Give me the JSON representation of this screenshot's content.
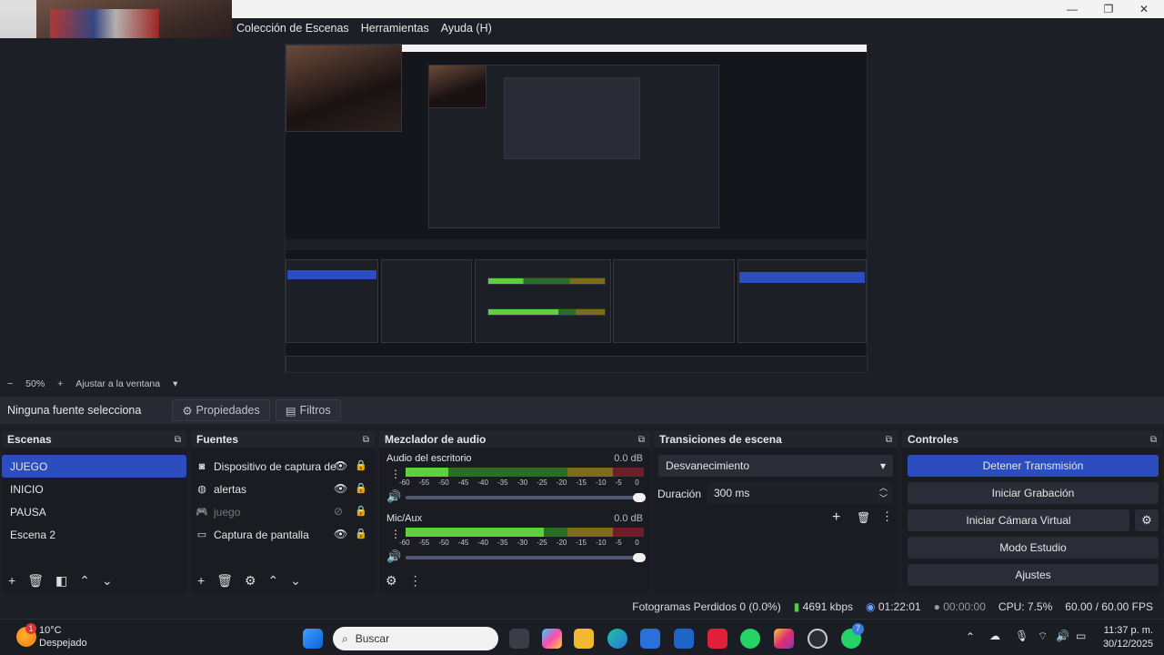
{
  "menu": [
    "Colección de Escenas",
    "Herramientas",
    "Ayuda (H)"
  ],
  "window_controls": {
    "minimize": "—",
    "maximize": "❐",
    "close": "✕"
  },
  "zoom": {
    "minus": "−",
    "level": "50%",
    "plus": "+",
    "fit_label": "Ajustar a la ventana",
    "dropdown": "▾"
  },
  "props": {
    "selection": "Ninguna fuente selecciona",
    "properties_label": "Propiedades",
    "filters_label": "Filtros"
  },
  "scenes": {
    "title": "Escenas",
    "items": [
      "JUEGO",
      "INICIO",
      "PAUSA",
      "Escena 2"
    ],
    "selected": "JUEGO"
  },
  "sources": {
    "title": "Fuentes",
    "items": [
      {
        "name": "Dispositivo de captura de",
        "icon": "camera-icon",
        "visible": true
      },
      {
        "name": "alertas",
        "icon": "globe-icon",
        "visible": true
      },
      {
        "name": "juego",
        "icon": "gamepad-icon",
        "visible": false
      },
      {
        "name": "Captura de pantalla",
        "icon": "monitor-icon",
        "visible": true
      }
    ]
  },
  "mixer": {
    "title": "Mezclador de audio",
    "scale": [
      "-60",
      "-55",
      "-50",
      "-45",
      "-40",
      "-35",
      "-30",
      "-25",
      "-20",
      "-15",
      "-10",
      "-5",
      "0"
    ],
    "channels": [
      {
        "name": "Audio del escritorio",
        "db": "0.0 dB",
        "level": 0.18,
        "volume": 1.0
      },
      {
        "name": "Mic/Aux",
        "db": "0.0 dB",
        "level": 0.58,
        "volume": 1.0
      }
    ]
  },
  "transitions": {
    "title": "Transiciones de escena",
    "selected": "Desvanecimiento",
    "duration_label": "Duración",
    "duration_value": "300 ms"
  },
  "controls": {
    "title": "Controles",
    "stop_stream": "Detener Transmisión",
    "start_recording": "Iniciar Grabación",
    "virtual_camera": "Iniciar Cámara Virtual",
    "studio_mode": "Modo Estudio",
    "settings": "Ajustes"
  },
  "status": {
    "dropped_frames": "Fotogramas Perdidos 0 (0.0%)",
    "bitrate": "4691 kbps",
    "stream_time": "01:22:01",
    "record_time": "00:00:00",
    "cpu": "CPU: 7.5%",
    "fps": "60.00 / 60.00 FPS"
  },
  "taskbar": {
    "weather_temp": "10°C",
    "weather_desc": "Despejado",
    "weather_badge": "1",
    "search_placeholder": "Buscar",
    "time": "11:37 p. m.",
    "date": "30/12/2025",
    "whatsapp_badge": "7"
  },
  "colors": {
    "accent": "#2b4dbf",
    "meter_green": "#5fcf3f",
    "bg": "#1d1f26"
  }
}
